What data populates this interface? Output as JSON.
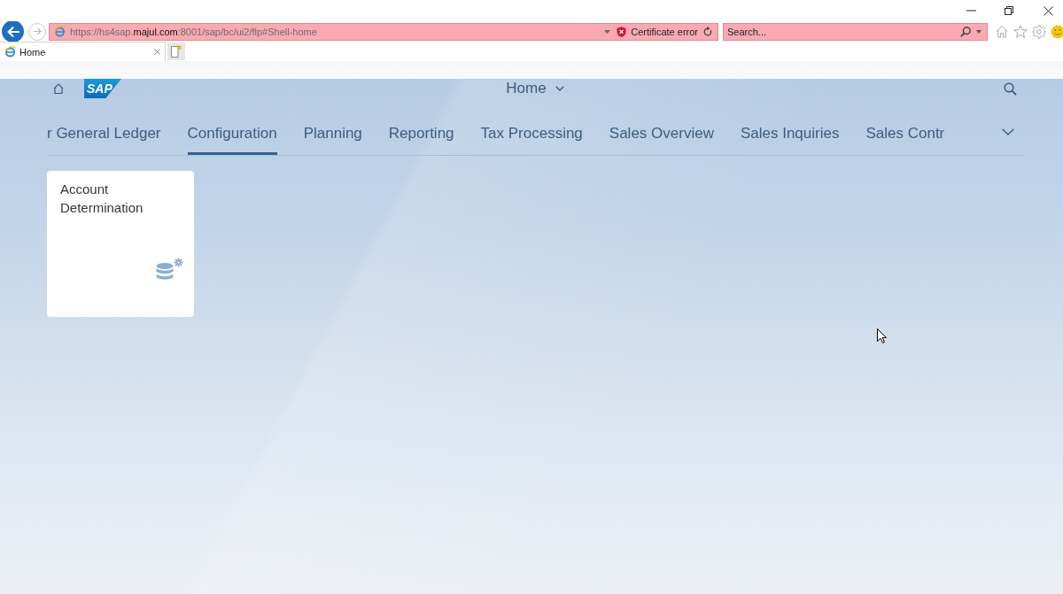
{
  "browser": {
    "address_bar": {
      "url": "https://hs4sap.**majul.com**:8001/sap/bc/ui2/flp#Shell-home",
      "security_status": "Certificate error"
    },
    "search_box": {
      "placeholder": "Search..."
    },
    "tabs": [
      {
        "title": "Home",
        "selected": true
      }
    ]
  },
  "shell_header": {
    "logo_text": "SAP",
    "title": "Home"
  },
  "tab_bar": {
    "tabs": [
      {
        "label": "r General Ledger",
        "selected": false
      },
      {
        "label": "Configuration",
        "selected": true
      },
      {
        "label": "Planning",
        "selected": false
      },
      {
        "label": "Reporting",
        "selected": false
      },
      {
        "label": "Tax Processing",
        "selected": false
      },
      {
        "label": "Sales Overview",
        "selected": false
      },
      {
        "label": "Sales Inquiries",
        "selected": false
      },
      {
        "label": "Sales Contr",
        "selected": false
      }
    ]
  },
  "tiles": [
    {
      "title": "Account Determination"
    }
  ]
}
